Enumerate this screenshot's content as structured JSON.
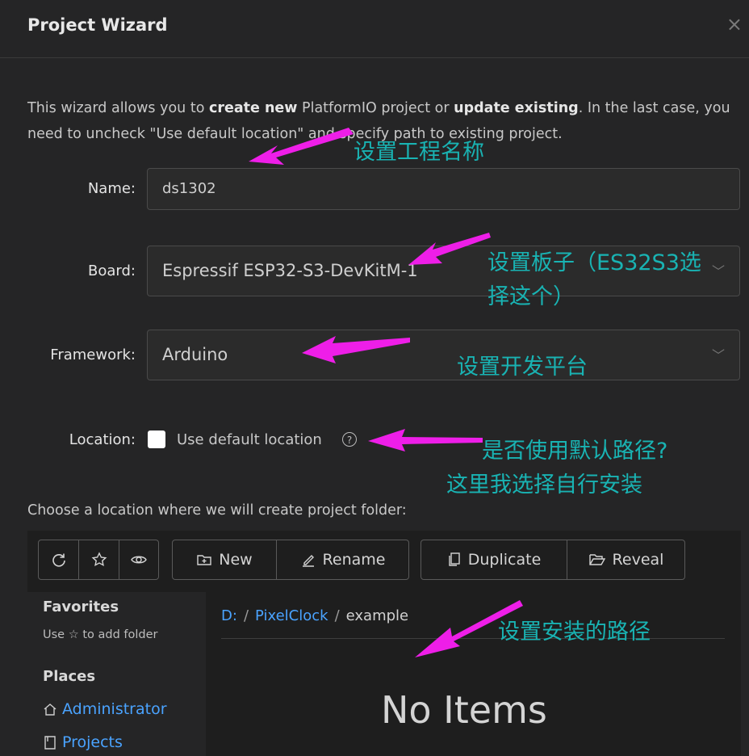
{
  "dialog": {
    "title": "Project Wizard",
    "close_icon": "×",
    "description": {
      "part1": "This wizard allows you to ",
      "bold1": "create new",
      "part2": " PlatformIO project or ",
      "bold2": "update existing",
      "part3": ". In the last case, you need to uncheck \"Use default location\" and specify path to existing project."
    }
  },
  "form": {
    "name_label": "Name:",
    "name_value": "ds1302",
    "board_label": "Board:",
    "board_value": "Espressif ESP32-S3-DevKitM-1",
    "framework_label": "Framework:",
    "framework_value": "Arduino",
    "location_label": "Location:",
    "use_default_label": "Use default location",
    "use_default_checked": false,
    "help_icon": "?",
    "choose_text": "Choose a location where we will create project folder:"
  },
  "browser": {
    "toolbar": {
      "refresh_icon": "refresh-icon",
      "star_icon": "star-icon",
      "eye_icon": "eye-icon",
      "new_label": "New",
      "rename_label": "Rename",
      "duplicate_label": "Duplicate",
      "reveal_label": "Reveal"
    },
    "sidebar": {
      "favorites_heading": "Favorites",
      "favorites_hint_pre": "Use",
      "favorites_hint_post": "to add folder",
      "places_heading": "Places",
      "place_1": "Administrator",
      "place_2": "Projects"
    },
    "breadcrumb": {
      "seg1": "D:",
      "seg2": "PixelClock",
      "seg3": "example",
      "separator": "/"
    },
    "empty_text": "No Items"
  },
  "annotations": {
    "name_note": "设置工程名称",
    "board_note_line1": "设置板子（ES32S3选",
    "board_note_line2": "择这个）",
    "framework_note": "设置开发平台",
    "location_note_line1": "是否使用默认路径?",
    "location_note_line2": "这里我选择自行安装",
    "path_note": "设置安装的路径"
  },
  "colors": {
    "background": "#252526",
    "link": "#4aa3ff",
    "annotation_text": "#19b3b3",
    "annotation_arrow": "#ee1ee8"
  }
}
